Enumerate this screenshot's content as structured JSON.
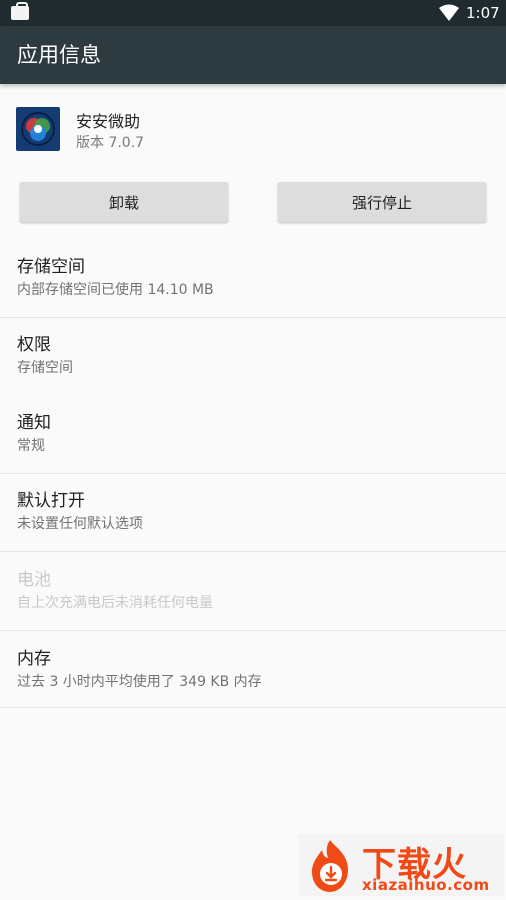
{
  "status_bar": {
    "time": "1:07"
  },
  "app_bar": {
    "title": "应用信息"
  },
  "app": {
    "name": "安安微助",
    "version": "版本 7.0.7"
  },
  "buttons": {
    "uninstall": "卸载",
    "force_stop": "强行停止"
  },
  "sections": {
    "storage": {
      "title": "存储空间",
      "subtitle": "内部存储空间已使用 14.10 MB"
    },
    "permissions": {
      "title": "权限",
      "subtitle": "存储空间"
    },
    "notifications": {
      "title": "通知",
      "subtitle": "常规"
    },
    "open_by_default": {
      "title": "默认打开",
      "subtitle": "未设置任何默认选项"
    },
    "battery": {
      "title": "电池",
      "subtitle": "自上次充满电后未消耗任何电量"
    },
    "memory": {
      "title": "内存",
      "subtitle": "过去 3 小时内平均使用了 349 KB 内存"
    }
  },
  "watermark": {
    "text": "下载火",
    "url": "xiazaihuo.com"
  },
  "colors": {
    "status_bar": "#1f2b2f",
    "app_bar": "#2d3a3f",
    "background": "#fafafa",
    "button": "#dddddd",
    "watermark_accent": "#f04a17"
  }
}
